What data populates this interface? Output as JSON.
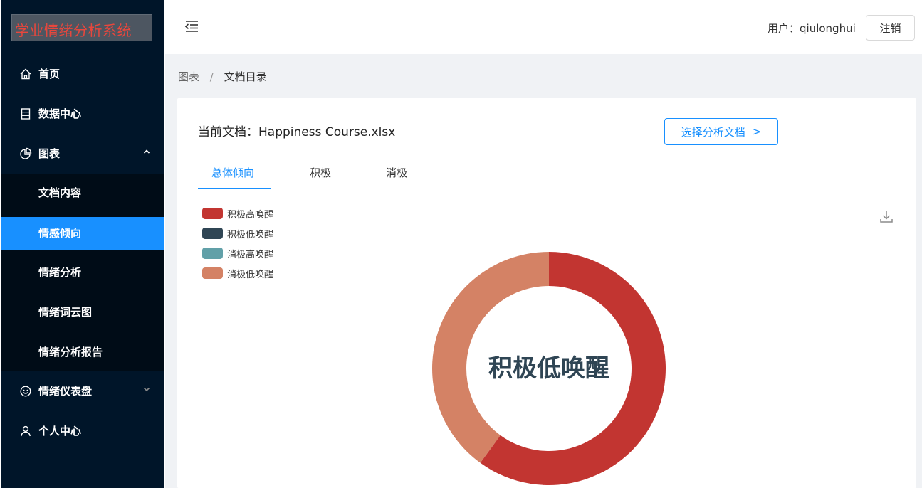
{
  "app": {
    "title": "学业情绪分析系统",
    "title_color": "#e8473d",
    "sidebar_bg": "#001529",
    "active_color": "#1890ff"
  },
  "sidebar": {
    "items": [
      {
        "label": "首页",
        "icon": "home-icon"
      },
      {
        "label": "数据中心",
        "icon": "database-icon"
      },
      {
        "label": "图表",
        "icon": "pie-chart-icon",
        "expanded": true
      },
      {
        "label": "情绪仪表盘",
        "icon": "smile-icon",
        "expanded": false
      },
      {
        "label": "个人中心",
        "icon": "user-icon"
      }
    ],
    "chart_submenu": [
      {
        "label": "文档内容"
      },
      {
        "label": "情感倾向",
        "active": true
      },
      {
        "label": "情绪分析"
      },
      {
        "label": "情绪词云图"
      },
      {
        "label": "情绪分析报告"
      }
    ]
  },
  "header": {
    "user_text": "用户：qiulonghui",
    "logout_label": "注销"
  },
  "breadcrumb": {
    "parent": "图表",
    "separator": "/",
    "current": "文档目录"
  },
  "document": {
    "title": "当前文档：Happiness Course.xlsx",
    "choose_label": "选择分析文档",
    "choose_chevron": ">"
  },
  "tabs": [
    {
      "label": "总体倾向",
      "active": true
    },
    {
      "label": "积极"
    },
    {
      "label": "消极"
    }
  ],
  "chart_data": {
    "type": "pie",
    "variant": "donut",
    "center_label": "积极低唤醒",
    "legend_position": "top-left",
    "series": [
      {
        "name": "积极高唤醒",
        "color": "#c23531",
        "value": 60
      },
      {
        "name": "积极低唤醒",
        "color": "#2f4554",
        "value": 0
      },
      {
        "name": "消极高唤醒",
        "color": "#61a0a8",
        "value": 0
      },
      {
        "name": "消极低唤醒",
        "color": "#d48265",
        "value": 40
      }
    ]
  }
}
